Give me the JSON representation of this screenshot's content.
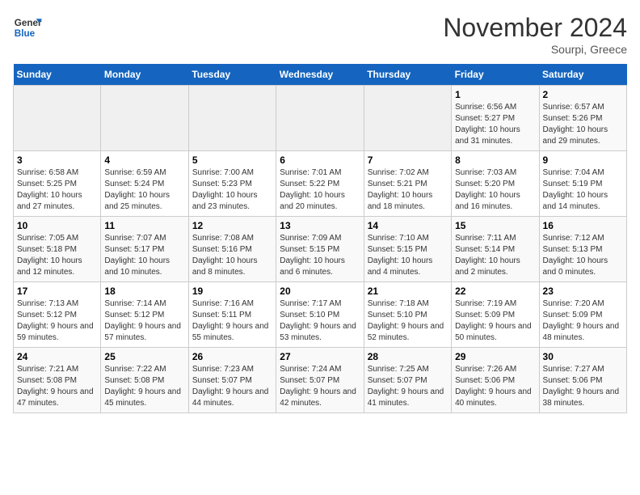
{
  "logo": {
    "line1": "General",
    "line2": "Blue"
  },
  "title": "November 2024",
  "subtitle": "Sourpi, Greece",
  "weekdays": [
    "Sunday",
    "Monday",
    "Tuesday",
    "Wednesday",
    "Thursday",
    "Friday",
    "Saturday"
  ],
  "weeks": [
    [
      {
        "day": "",
        "info": ""
      },
      {
        "day": "",
        "info": ""
      },
      {
        "day": "",
        "info": ""
      },
      {
        "day": "",
        "info": ""
      },
      {
        "day": "",
        "info": ""
      },
      {
        "day": "1",
        "info": "Sunrise: 6:56 AM\nSunset: 5:27 PM\nDaylight: 10 hours and 31 minutes."
      },
      {
        "day": "2",
        "info": "Sunrise: 6:57 AM\nSunset: 5:26 PM\nDaylight: 10 hours and 29 minutes."
      }
    ],
    [
      {
        "day": "3",
        "info": "Sunrise: 6:58 AM\nSunset: 5:25 PM\nDaylight: 10 hours and 27 minutes."
      },
      {
        "day": "4",
        "info": "Sunrise: 6:59 AM\nSunset: 5:24 PM\nDaylight: 10 hours and 25 minutes."
      },
      {
        "day": "5",
        "info": "Sunrise: 7:00 AM\nSunset: 5:23 PM\nDaylight: 10 hours and 23 minutes."
      },
      {
        "day": "6",
        "info": "Sunrise: 7:01 AM\nSunset: 5:22 PM\nDaylight: 10 hours and 20 minutes."
      },
      {
        "day": "7",
        "info": "Sunrise: 7:02 AM\nSunset: 5:21 PM\nDaylight: 10 hours and 18 minutes."
      },
      {
        "day": "8",
        "info": "Sunrise: 7:03 AM\nSunset: 5:20 PM\nDaylight: 10 hours and 16 minutes."
      },
      {
        "day": "9",
        "info": "Sunrise: 7:04 AM\nSunset: 5:19 PM\nDaylight: 10 hours and 14 minutes."
      }
    ],
    [
      {
        "day": "10",
        "info": "Sunrise: 7:05 AM\nSunset: 5:18 PM\nDaylight: 10 hours and 12 minutes."
      },
      {
        "day": "11",
        "info": "Sunrise: 7:07 AM\nSunset: 5:17 PM\nDaylight: 10 hours and 10 minutes."
      },
      {
        "day": "12",
        "info": "Sunrise: 7:08 AM\nSunset: 5:16 PM\nDaylight: 10 hours and 8 minutes."
      },
      {
        "day": "13",
        "info": "Sunrise: 7:09 AM\nSunset: 5:15 PM\nDaylight: 10 hours and 6 minutes."
      },
      {
        "day": "14",
        "info": "Sunrise: 7:10 AM\nSunset: 5:15 PM\nDaylight: 10 hours and 4 minutes."
      },
      {
        "day": "15",
        "info": "Sunrise: 7:11 AM\nSunset: 5:14 PM\nDaylight: 10 hours and 2 minutes."
      },
      {
        "day": "16",
        "info": "Sunrise: 7:12 AM\nSunset: 5:13 PM\nDaylight: 10 hours and 0 minutes."
      }
    ],
    [
      {
        "day": "17",
        "info": "Sunrise: 7:13 AM\nSunset: 5:12 PM\nDaylight: 9 hours and 59 minutes."
      },
      {
        "day": "18",
        "info": "Sunrise: 7:14 AM\nSunset: 5:12 PM\nDaylight: 9 hours and 57 minutes."
      },
      {
        "day": "19",
        "info": "Sunrise: 7:16 AM\nSunset: 5:11 PM\nDaylight: 9 hours and 55 minutes."
      },
      {
        "day": "20",
        "info": "Sunrise: 7:17 AM\nSunset: 5:10 PM\nDaylight: 9 hours and 53 minutes."
      },
      {
        "day": "21",
        "info": "Sunrise: 7:18 AM\nSunset: 5:10 PM\nDaylight: 9 hours and 52 minutes."
      },
      {
        "day": "22",
        "info": "Sunrise: 7:19 AM\nSunset: 5:09 PM\nDaylight: 9 hours and 50 minutes."
      },
      {
        "day": "23",
        "info": "Sunrise: 7:20 AM\nSunset: 5:09 PM\nDaylight: 9 hours and 48 minutes."
      }
    ],
    [
      {
        "day": "24",
        "info": "Sunrise: 7:21 AM\nSunset: 5:08 PM\nDaylight: 9 hours and 47 minutes."
      },
      {
        "day": "25",
        "info": "Sunrise: 7:22 AM\nSunset: 5:08 PM\nDaylight: 9 hours and 45 minutes."
      },
      {
        "day": "26",
        "info": "Sunrise: 7:23 AM\nSunset: 5:07 PM\nDaylight: 9 hours and 44 minutes."
      },
      {
        "day": "27",
        "info": "Sunrise: 7:24 AM\nSunset: 5:07 PM\nDaylight: 9 hours and 42 minutes."
      },
      {
        "day": "28",
        "info": "Sunrise: 7:25 AM\nSunset: 5:07 PM\nDaylight: 9 hours and 41 minutes."
      },
      {
        "day": "29",
        "info": "Sunrise: 7:26 AM\nSunset: 5:06 PM\nDaylight: 9 hours and 40 minutes."
      },
      {
        "day": "30",
        "info": "Sunrise: 7:27 AM\nSunset: 5:06 PM\nDaylight: 9 hours and 38 minutes."
      }
    ]
  ]
}
